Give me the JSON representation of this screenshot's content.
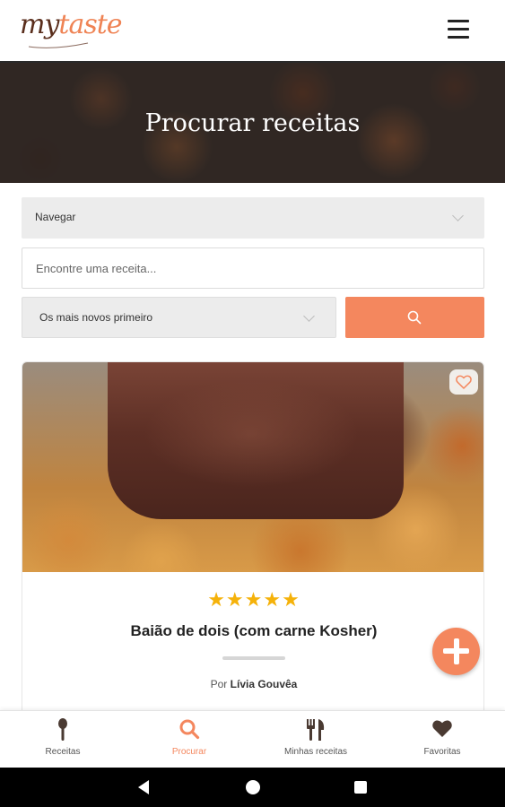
{
  "app": {
    "logo_part1": "my",
    "logo_part2": "taste",
    "brand_color": "#ef8354",
    "logo_dark_color": "#5a2e1c"
  },
  "hero": {
    "title": "Procurar receitas"
  },
  "search": {
    "browse_label": "Navegar",
    "input_placeholder": "Encontre uma receita...",
    "input_value": "",
    "sort_selected": "Os mais novos primeiro",
    "search_button_icon": "search-icon",
    "accent_color": "#f4875e"
  },
  "recipe_card": {
    "rating": 5,
    "rating_max": 5,
    "stars_text": "★★★★★",
    "title": "Baião de dois (com carne Kosher)",
    "author_prefix": "Por",
    "author_name": "Lívia Gouvêa",
    "favorite_icon": "heart-outline-icon",
    "star_color": "#f5b20a"
  },
  "fab": {
    "icon": "plus-icon"
  },
  "bottom_nav": {
    "items": [
      {
        "label": "Receitas",
        "icon": "spoon-icon",
        "active": false
      },
      {
        "label": "Procurar",
        "icon": "search-icon",
        "active": true
      },
      {
        "label": "Minhas receitas",
        "icon": "fork-knife-icon",
        "active": false
      },
      {
        "label": "Favoritas",
        "icon": "heart-icon",
        "active": false
      }
    ]
  },
  "system_nav": {
    "icons": [
      "back-icon",
      "home-icon",
      "recents-icon"
    ]
  }
}
